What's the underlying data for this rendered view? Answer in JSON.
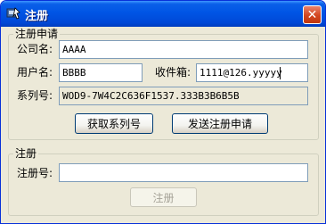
{
  "window": {
    "title": "注册",
    "close_symbol": "✕"
  },
  "apply_group": {
    "legend": "注册申请",
    "company_label": "公司名:",
    "company_value": "AAAA",
    "username_label": "用户名:",
    "username_value": "BBBB",
    "mailbox_label": "收件箱:",
    "mailbox_value": "1111@126.yyyyy",
    "serial_label": "系列号:",
    "serial_value": "WOD9-7W4C2C636F1537.333B3B6B5B",
    "get_serial_button": "获取系列号",
    "send_request_button": "发送注册申请"
  },
  "register_group": {
    "legend": "注册",
    "code_label": "注册号:",
    "code_value": "",
    "register_button": "注册"
  },
  "colors": {
    "titlebar": "#0055e5",
    "window_bg": "#ece9d8",
    "close_button": "#d3461f",
    "input_border": "#7f9db9"
  }
}
